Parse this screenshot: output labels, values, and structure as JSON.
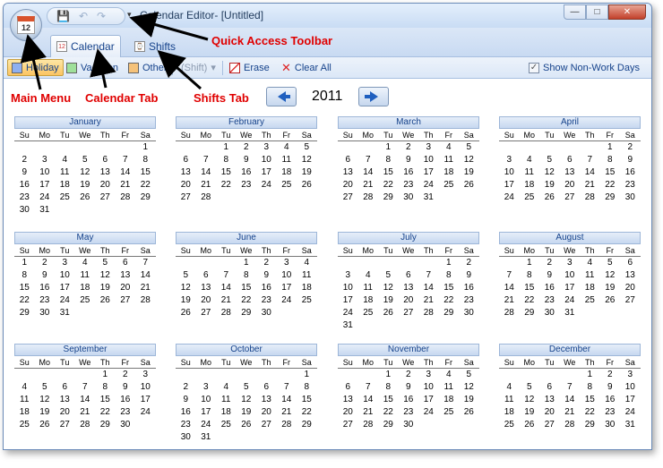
{
  "window": {
    "title": "Calendar Editor- [Untitled]",
    "orb_label": "12",
    "controls": {
      "minimize": "—",
      "maximize": "□",
      "close": "✕"
    }
  },
  "qat": {
    "save": "💾",
    "undo": "↶",
    "redo": "↷",
    "dropdown": "▾"
  },
  "tabs": [
    {
      "label": "Calendar",
      "active": true
    },
    {
      "label": "Shifts",
      "active": false
    }
  ],
  "toolbar": {
    "holiday": "Holiday",
    "vacation": "Vacation",
    "other": "Other",
    "shift": "(Shift)",
    "shift_dd": "▾",
    "erase": "Erase",
    "clear_all": "Clear All",
    "show_non_work": "Show Non-Work Days",
    "show_non_work_checked": true,
    "colors": {
      "holiday": "#8fb0f0",
      "vacation": "#9fe09a",
      "other": "#f5c27a"
    }
  },
  "year": "2011",
  "weekdays": [
    "Su",
    "Mo",
    "Tu",
    "We",
    "Th",
    "Fr",
    "Sa"
  ],
  "months": [
    {
      "name": "January",
      "start": 6,
      "days": 31
    },
    {
      "name": "February",
      "start": 2,
      "days": 28
    },
    {
      "name": "March",
      "start": 2,
      "days": 31
    },
    {
      "name": "April",
      "start": 5,
      "days": 30
    },
    {
      "name": "May",
      "start": 0,
      "days": 31
    },
    {
      "name": "June",
      "start": 3,
      "days": 30
    },
    {
      "name": "July",
      "start": 5,
      "days": 31
    },
    {
      "name": "August",
      "start": 1,
      "days": 31
    },
    {
      "name": "September",
      "start": 4,
      "days": 30
    },
    {
      "name": "October",
      "start": 6,
      "days": 31
    },
    {
      "name": "November",
      "start": 2,
      "days": 30
    },
    {
      "name": "December",
      "start": 4,
      "days": 31
    }
  ],
  "annotations": {
    "qat": "Quick Access Toolbar",
    "main_menu": "Main Menu",
    "calendar_tab": "Calendar Tab",
    "shifts_tab": "Shifts Tab"
  }
}
